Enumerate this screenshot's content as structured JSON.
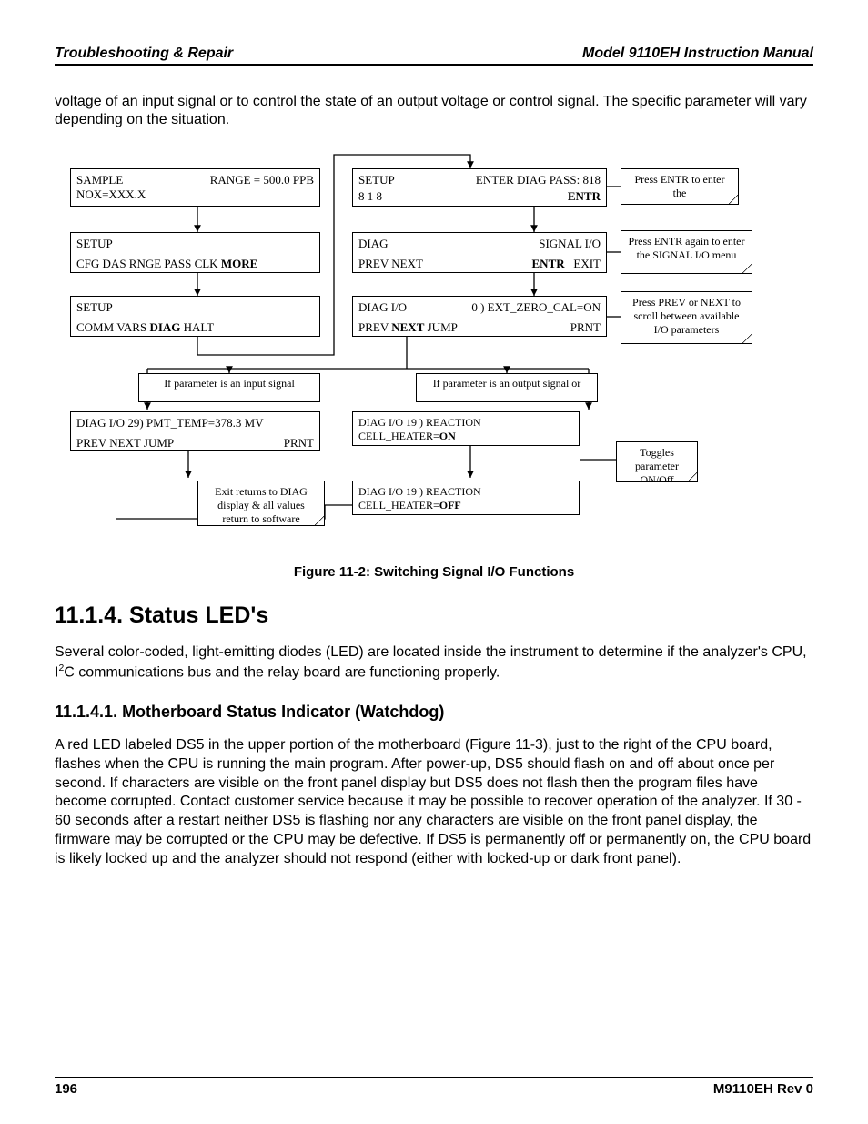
{
  "header": {
    "left": "Troubleshooting & Repair",
    "right": "Model 9110EH Instruction Manual"
  },
  "intro": "voltage of an input signal or to control the state of an output voltage or control signal. The specific parameter will vary depending on the situation.",
  "diag": {
    "s1a": "SAMPLE",
    "s1b": "RANGE = 500.0 PPB",
    "s1c": "NOX=XXX.X",
    "s2a": "SETUP",
    "s2b": "CFG  DAS  RNGE  PASS  CLK",
    "s2c": "MORE",
    "s3a": "SETUP",
    "s3b": "COMM  VARS",
    "s3c": "DIAG",
    "s3d": "HALT",
    "s4a": "SETUP",
    "s4b": "ENTER DIAG PASS: 818",
    "s4c": "8    1    8",
    "s4d": "ENTR",
    "s5a": "DIAG",
    "s5b": "SIGNAL I/O",
    "s5c": "PREV   NEXT",
    "s5d": "ENTR",
    "s5e": "EXIT",
    "s6a": "DIAG  I/O",
    "s6b": "0 )  EXT_ZERO_CAL=ON",
    "s6c": "PREV",
    "s6d": "NEXT",
    "s6e": "JUMP",
    "s6f": "PRNT",
    "s7a": "DIAG  I/O      29)  PMT_TEMP=378.3 MV",
    "s7b": "PREV NEXT JUMP",
    "s7c": "PRNT",
    "s8a": "DIAG I/O         19 )  REACTION",
    "s8b": "CELL_HEATER=",
    "s8c": "ON",
    "s9a": "DIAG I/O         19 )  REACTION",
    "s9b": "CELL_HEATER=",
    "s9c": "OFF",
    "d1": "If parameter is an input signal",
    "d2": "If parameter is an output signal or",
    "n1": "Press ENTR to enter the",
    "n2": "Press ENTR again to enter the SIGNAL I/O menu",
    "n3": "Press PREV or NEXT to scroll between available I/O parameters",
    "n4": "Toggles parameter ON/Off",
    "n5": "Exit returns to DIAG display & all values return to software"
  },
  "figcap": "Figure 11-2: Switching Signal I/O Functions",
  "sec_h": "11.1.4. Status LED's",
  "sec_p": "Several color-coded, light-emitting diodes (LED) are located inside the instrument to determine if the analyzer's CPU, I",
  "sec_p_sup": "2",
  "sec_p2": "C communications bus and the relay board are functioning properly.",
  "sub_h": "11.1.4.1. Motherboard Status Indicator (Watchdog)",
  "sub_p": "A red LED labeled DS5 in the upper portion of the motherboard (Figure 11-3), just to the right of the CPU board, flashes when the CPU is running the main program. After power-up, DS5 should flash on and off about once per second. If characters are visible on the front panel display but DS5 does not flash then the program files have become corrupted. Contact customer service because it may be possible to recover operation of the analyzer. If 30 - 60 seconds after a restart neither DS5 is flashing nor any characters are visible on the front panel display, the firmware may be corrupted or the CPU may be defective. If DS5 is permanently off or permanently on, the CPU board is likely locked up and the analyzer should not respond (either with locked-up or dark front panel).",
  "footer": {
    "left": "196",
    "right": "M9110EH Rev 0"
  }
}
